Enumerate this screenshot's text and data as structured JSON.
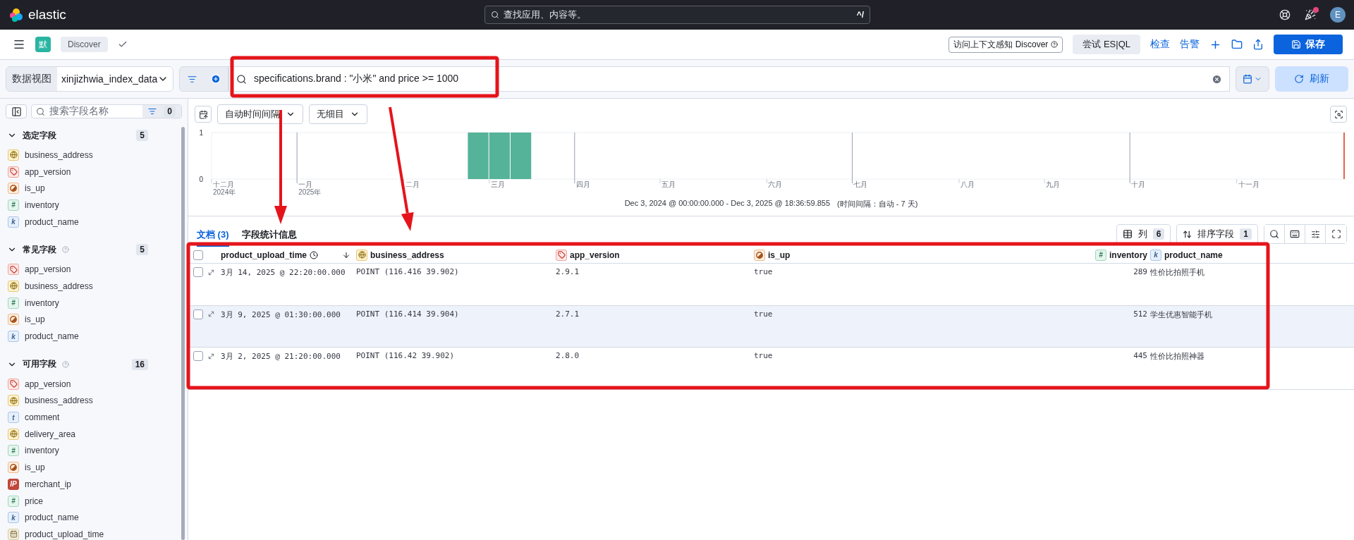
{
  "top_bar": {
    "logo": "elastic",
    "search": {
      "placeholder": "查找应用、内容等。",
      "shortcut": "^/"
    },
    "news_unread": true,
    "avatar": "E"
  },
  "nav_bar": {
    "space_badge": "默",
    "breadcrumb": "Discover",
    "actions": [
      {
        "kind": "outline",
        "label": "访问上下文感知 Discover"
      },
      {
        "kind": "soft",
        "label": "尝试 ES|QL"
      },
      {
        "kind": "link",
        "label": "检查"
      },
      {
        "kind": "link",
        "label": "告警"
      },
      {
        "kind": "plus"
      },
      {
        "kind": "folder"
      },
      {
        "kind": "share"
      }
    ],
    "save": "保存"
  },
  "query_bar": {
    "data_view_label": "数据视图",
    "data_view": "xinjizhwia_index_data",
    "query": "specifications.brand : \"小米\" and price >= 1000",
    "refresh": "刷新"
  },
  "sidebar": {
    "search": {
      "placeholder": "搜索字段名称"
    },
    "filter_count": "0",
    "sections": [
      {
        "title": "选定字段",
        "help": false,
        "expanded": true,
        "count": "5",
        "fields": [
          {
            "name": "business_address",
            "kind": "geo"
          },
          {
            "name": "app_version",
            "kind": "version"
          },
          {
            "name": "is_up",
            "kind": "boolean"
          },
          {
            "name": "inventory",
            "kind": "number",
            "glyph": "#"
          },
          {
            "name": "product_name",
            "kind": "keyword",
            "glyph": "k"
          }
        ]
      },
      {
        "title": "常见字段",
        "help": true,
        "expanded": true,
        "count": "5",
        "fields": [
          {
            "name": "app_version",
            "kind": "version"
          },
          {
            "name": "business_address",
            "kind": "geo"
          },
          {
            "name": "inventory",
            "kind": "number",
            "glyph": "#"
          },
          {
            "name": "is_up",
            "kind": "boolean"
          },
          {
            "name": "product_name",
            "kind": "keyword",
            "glyph": "k"
          }
        ]
      },
      {
        "title": "可用字段",
        "help": true,
        "expanded": true,
        "count": "16",
        "fields": [
          {
            "name": "app_version",
            "kind": "version"
          },
          {
            "name": "business_address",
            "kind": "geo"
          },
          {
            "name": "comment",
            "kind": "text",
            "glyph": "t"
          },
          {
            "name": "delivery_area",
            "kind": "geo"
          },
          {
            "name": "inventory",
            "kind": "number",
            "glyph": "#"
          },
          {
            "name": "is_up",
            "kind": "boolean"
          },
          {
            "name": "merchant_ip",
            "kind": "ip",
            "glyph": "IP"
          },
          {
            "name": "price",
            "kind": "number",
            "glyph": "#"
          },
          {
            "name": "product_name",
            "kind": "keyword",
            "glyph": "k"
          },
          {
            "name": "product_upload_time",
            "kind": "date"
          }
        ]
      }
    ]
  },
  "chart_toolbar": {
    "interval": "自动时间间隔",
    "breakdown": "无细目"
  },
  "histogram": {
    "chart_data": {
      "type": "bar",
      "yticks": [
        0,
        1
      ],
      "ylim": [
        0,
        1
      ],
      "categories": [
        "十二月\n2024年",
        null,
        null,
        null,
        "一月\n2025年",
        null,
        null,
        null,
        null,
        "二月",
        null,
        null,
        null,
        "三月",
        null,
        null,
        null,
        "四月",
        null,
        null,
        null,
        "五月",
        null,
        null,
        null,
        null,
        "六月",
        null,
        null,
        null,
        "七月",
        null,
        null,
        null,
        null,
        "八月",
        null,
        null,
        null,
        "九月",
        null,
        null,
        null,
        "十月",
        null,
        null,
        null,
        null,
        "十一月",
        null,
        null,
        null,
        null
      ],
      "values": [
        null,
        null,
        null,
        null,
        null,
        null,
        null,
        null,
        null,
        null,
        null,
        null,
        1,
        1,
        1,
        null,
        null,
        null,
        null,
        null,
        null,
        null,
        null,
        null,
        null,
        null,
        null,
        null,
        null,
        null,
        null,
        null,
        null,
        null,
        null,
        null,
        null,
        null,
        null,
        null,
        null,
        null,
        null,
        null,
        null,
        null,
        null,
        null,
        null,
        null,
        null,
        null,
        null
      ]
    },
    "time_range": "Dec 3, 2024 @ 00:00:00.000 - Dec 3, 2025 @ 18:36:59.855",
    "interval_note": "(时间间隔：自动 - 7 天)"
  },
  "tabs": [
    {
      "label": "文档 (3)",
      "selected": true
    },
    {
      "label": "字段统计信息",
      "selected": false
    }
  ],
  "table_controls": {
    "columns_label": "列",
    "columns_count": "6",
    "sort_label": "排序字段",
    "sort_count": "1"
  },
  "table": {
    "all_selected": false,
    "columns": [
      {
        "name": "product_upload_time",
        "kind": "time",
        "sorted": true
      },
      {
        "name": "business_address",
        "kind": "geo"
      },
      {
        "name": "app_version",
        "kind": "version"
      },
      {
        "name": "is_up",
        "kind": "boolean"
      },
      {
        "name": "inventory",
        "kind": "number",
        "glyph": "#"
      },
      {
        "name": "product_name",
        "kind": "keyword",
        "glyph": "k"
      }
    ],
    "rows": [
      {
        "selected": false,
        "hovered": false,
        "cells": [
          "3月 14, 2025 @ 22:20:00.000",
          "POINT (116.416 39.902)",
          "2.9.1",
          "true",
          "289",
          "性价比拍照手机"
        ]
      },
      {
        "selected": false,
        "hovered": true,
        "cells": [
          "3月 9, 2025 @ 01:30:00.000",
          "POINT (116.414 39.904)",
          "2.7.1",
          "true",
          "512",
          "学生优惠智能手机"
        ]
      },
      {
        "selected": false,
        "hovered": false,
        "cells": [
          "3月 2, 2025 @ 21:20:00.000",
          "POINT (116.42 39.902)",
          "2.8.0",
          "true",
          "445",
          "性价比拍照神器"
        ]
      }
    ]
  },
  "annotations": [
    {
      "kind": "box"
    },
    {
      "kind": "box"
    },
    {
      "kind": "arrow"
    },
    {
      "kind": "arrow"
    }
  ]
}
